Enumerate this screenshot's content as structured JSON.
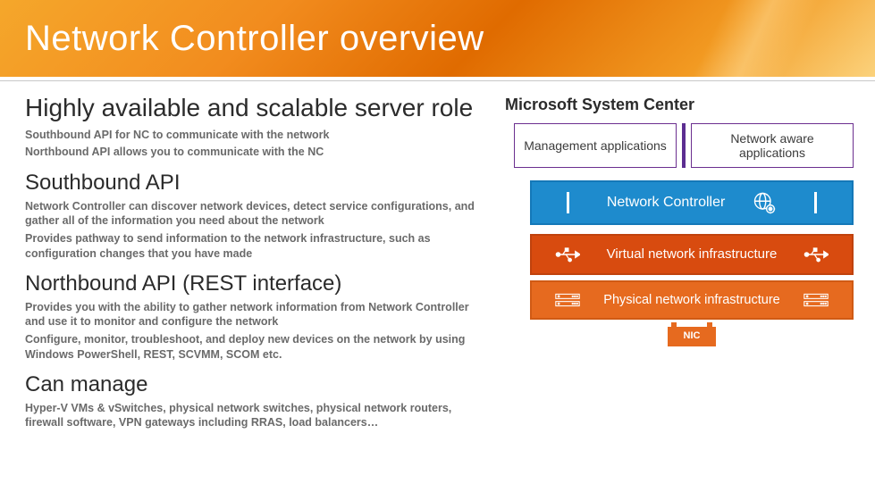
{
  "header": {
    "title": "Network Controller overview"
  },
  "left": {
    "main_heading": "Highly available and scalable server role",
    "main_sub": [
      "Southbound API for NC to communicate with the network",
      "Northbound API allows you to communicate with the NC"
    ],
    "southbound": {
      "heading": "Southbound API",
      "paras": [
        "Network Controller can discover network devices, detect service configurations, and gather all of the information you need about the network",
        "Provides pathway to send information to the network infrastructure, such as configuration changes that you have made"
      ]
    },
    "northbound": {
      "heading": "Northbound API (REST interface)",
      "paras": [
        "Provides you with the ability to gather network information from Network Controller and use it to monitor and configure the network",
        "Configure, monitor, troubleshoot, and deploy new devices on the network by using Windows PowerShell, REST, SCVMM, SCOM etc."
      ]
    },
    "can_manage": {
      "heading": "Can manage",
      "paras": [
        "Hyper-V VMs & vSwitches, physical network switches, physical network routers, firewall software, VPN gateways including RRAS, load balancers…"
      ]
    }
  },
  "right": {
    "title": "Microsoft System Center",
    "apps": [
      "Management applications",
      "Network aware applications"
    ],
    "controller": "Network Controller",
    "virtual": "Virtual network infrastructure",
    "physical": "Physical network infrastructure",
    "nic": "NIC"
  }
}
